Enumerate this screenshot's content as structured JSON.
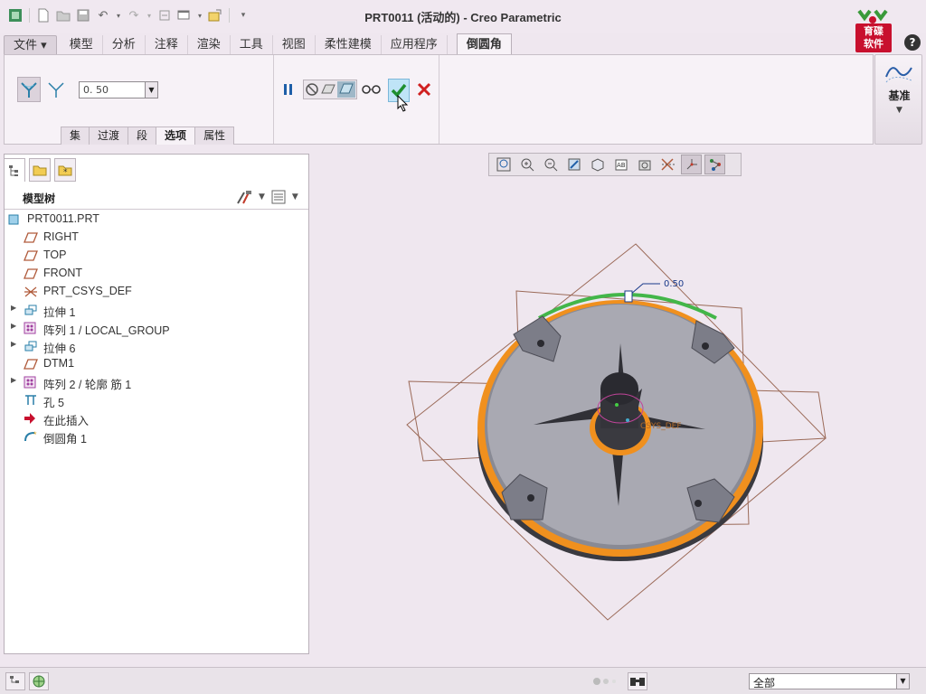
{
  "window": {
    "title": "PRT0011 (活动的) - Creo Parametric"
  },
  "brand": {
    "text_line1": "育碟",
    "text_line2": "软件"
  },
  "ribbon": {
    "tabs": [
      {
        "label": "文件",
        "kind": "file"
      },
      {
        "label": "模型"
      },
      {
        "label": "分析"
      },
      {
        "label": "注释"
      },
      {
        "label": "渲染"
      },
      {
        "label": "工具"
      },
      {
        "label": "视图"
      },
      {
        "label": "柔性建模"
      },
      {
        "label": "应用程序"
      }
    ],
    "active_tab": "倒圆角",
    "radius_value": "0. 50",
    "subtabs": [
      "集",
      "过渡",
      "段",
      "选项",
      "属性"
    ],
    "selected_subtab": "选项",
    "datum_label": "基准"
  },
  "model_tree": {
    "title": "模型树",
    "items": [
      {
        "label": "PRT0011.PRT",
        "icon": "part-icon",
        "expandable": false,
        "indent": 0
      },
      {
        "label": "RIGHT",
        "icon": "datum-plane-icon",
        "expandable": false,
        "indent": 1
      },
      {
        "label": "TOP",
        "icon": "datum-plane-icon",
        "expandable": false,
        "indent": 1
      },
      {
        "label": "FRONT",
        "icon": "datum-plane-icon",
        "expandable": false,
        "indent": 1
      },
      {
        "label": "PRT_CSYS_DEF",
        "icon": "csys-icon",
        "expandable": false,
        "indent": 1
      },
      {
        "label": "拉伸 1",
        "icon": "extrude-icon",
        "expandable": true,
        "indent": 1
      },
      {
        "label": "阵列 1 / LOCAL_GROUP",
        "icon": "pattern-icon",
        "expandable": true,
        "indent": 1
      },
      {
        "label": "拉伸 6",
        "icon": "extrude-icon",
        "expandable": true,
        "indent": 1
      },
      {
        "label": "DTM1",
        "icon": "datum-plane-icon",
        "expandable": false,
        "indent": 1
      },
      {
        "label": "阵列 2 / 轮廓 筋 1",
        "icon": "pattern-icon",
        "expandable": true,
        "indent": 1
      },
      {
        "label": "孔 5",
        "icon": "hole-icon",
        "expandable": false,
        "indent": 1
      },
      {
        "label": "在此插入",
        "icon": "insert-arrow-icon",
        "expandable": false,
        "indent": 1
      },
      {
        "label": "倒圆角 1",
        "icon": "round-icon",
        "expandable": false,
        "indent": 1
      }
    ]
  },
  "viewport": {
    "dimension_label": "0.50",
    "csys_label": "CSYS_DEF"
  },
  "statusbar": {
    "filter_value": "全部"
  },
  "colors": {
    "accent_orange": "#f0901e",
    "edge_green": "#43b649",
    "ok_green": "#1f8f2f",
    "cancel_red": "#d02020"
  }
}
